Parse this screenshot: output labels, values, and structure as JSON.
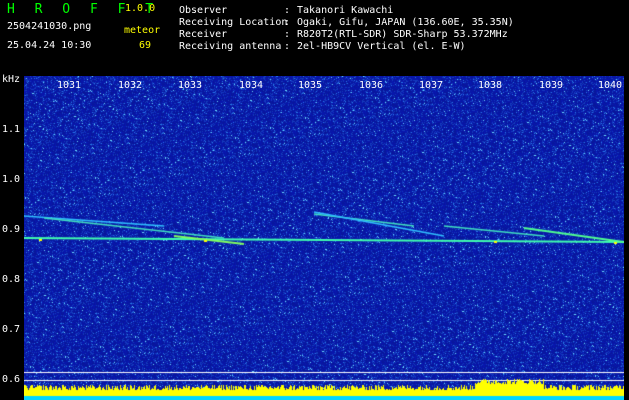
{
  "header": {
    "app_name": "H R O F F T",
    "app_version": "1.0.0",
    "file_name": "2504241030.png",
    "mode": "meteor",
    "timestamp": "25.04.24 10:30",
    "count": "69"
  },
  "info": [
    {
      "label": "Observer",
      "value": "Takanori Kawachi"
    },
    {
      "label": "Receiving Location",
      "value": "Ogaki, Gifu, JAPAN (136.60E, 35.35N)"
    },
    {
      "label": "Receiver",
      "value": "R820T2(RTL-SDR) SDR-Sharp 53.372MHz"
    },
    {
      "label": "Receiving antenna",
      "value": "2el-HB9CV Vertical (el. E-W)"
    }
  ],
  "separator": ":",
  "chart_data": {
    "type": "heatmap",
    "ylabel": "kHz",
    "y_ticks": [
      "1.1",
      "1.0",
      "0.9",
      "0.8",
      "0.7",
      "0.6"
    ],
    "x_ticks": [
      "1031",
      "1032",
      "1033",
      "1034",
      "1035",
      "1036",
      "1037",
      "1038",
      "1039",
      "1040"
    ],
    "colors": {
      "background": "#0a1aa0",
      "noise": "#1e5ad8",
      "signal": "#40ffb0",
      "peak": "#ffff00",
      "text": "#ffffff"
    }
  }
}
